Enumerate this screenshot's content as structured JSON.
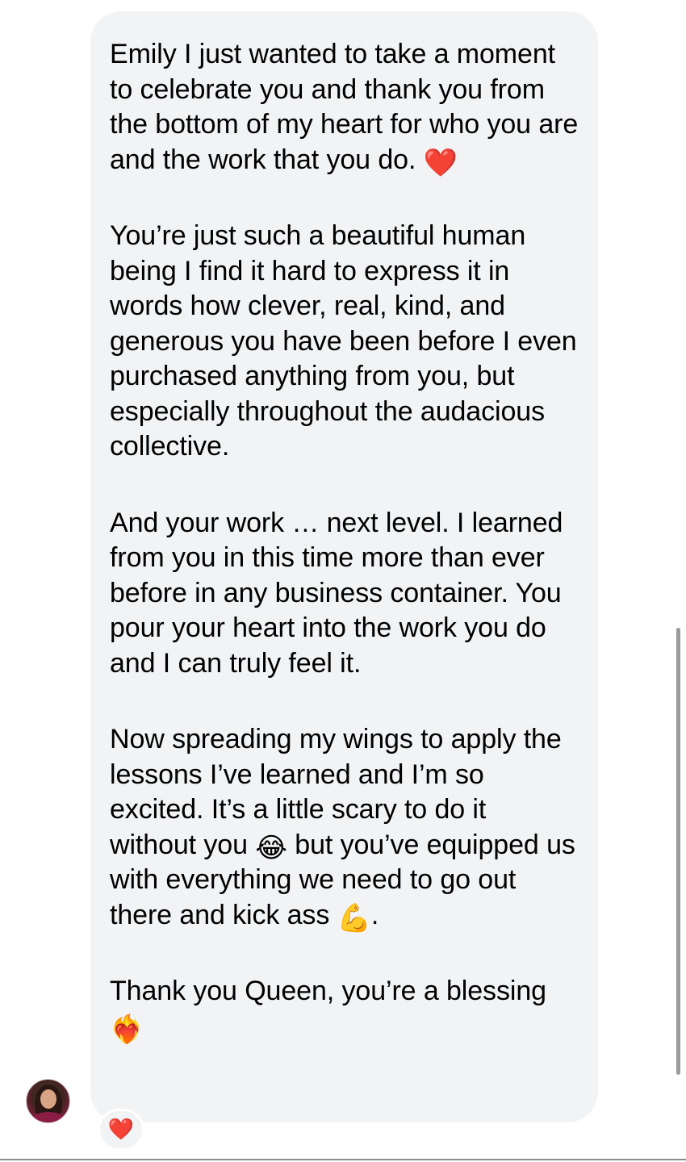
{
  "message": {
    "paragraph_1": "Emily I just wanted to take a moment to celebrate you and thank you from the bottom of my heart for who you are and the work that you do.",
    "paragraph_1_emoji": "❤️",
    "paragraph_2": "You’re just such a beautiful human being I find it hard to express it in words how clever, real, kind, and generous you have been before I even purchased anything from you, but especially throughout the audacious collective.",
    "paragraph_3": "And your work … next level. I learned from you in this time more than ever before in any business container. You pour your heart into the work you do and I can truly feel it.",
    "paragraph_4_part_1": "Now spreading my wings to apply the lessons I’ve learned and I’m so excited. It’s a little scary to do it without you",
    "paragraph_4_emoji_1": "😂",
    "paragraph_4_part_2": "but you’ve equipped us with everything we need to go out there and kick ass",
    "paragraph_4_emoji_2": "💪",
    "paragraph_4_end": ".",
    "paragraph_5": "Thank you Queen, you’re a blessing",
    "paragraph_5_emoji": "❤️‍🔥"
  },
  "reaction": {
    "emoji": "❤️"
  },
  "icons": {
    "avatar": "sender-avatar"
  },
  "colors": {
    "bubble_background": "#f2f3f5",
    "text": "#000000",
    "heart": "#e8201a",
    "scrollbar": "#9b9b9b"
  }
}
